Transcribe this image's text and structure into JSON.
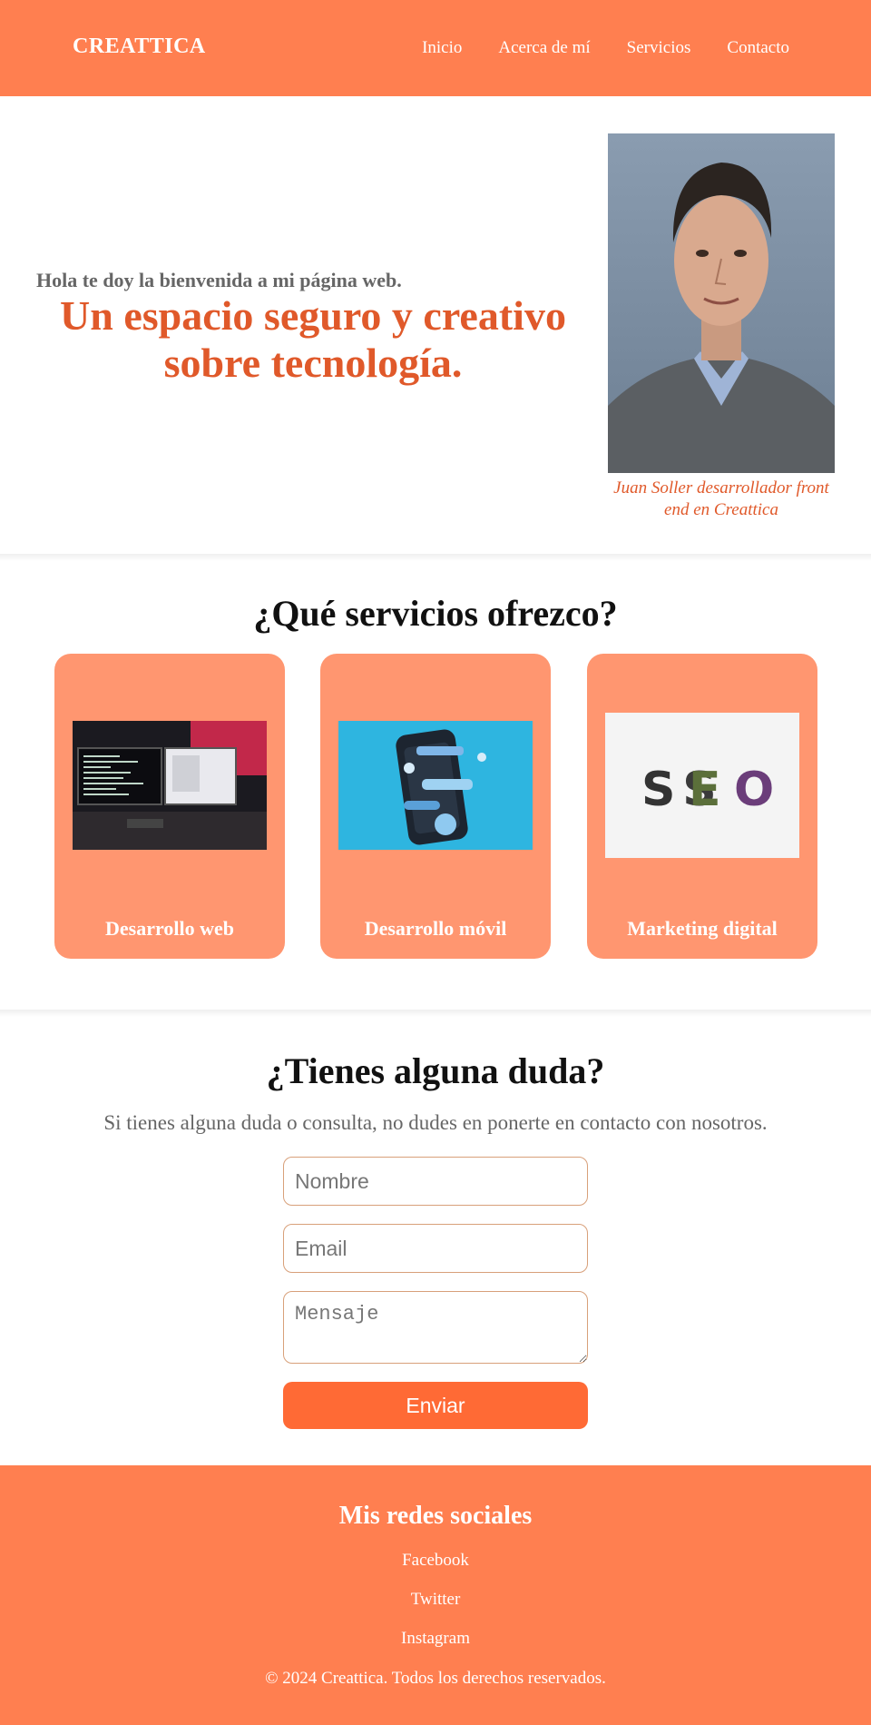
{
  "header": {
    "brand": "CREATTICA",
    "nav": [
      "Inicio",
      "Acerca de mí",
      "Servicios",
      "Contacto"
    ]
  },
  "hero": {
    "subtitle": "Hola te doy la bienvenida a mi página web.",
    "title": "Un espacio seguro y creativo sobre tecnología.",
    "caption": "Juan Soller desarrollador front end en Creattica"
  },
  "services": {
    "title": "¿Qué servicios ofrezco?",
    "cards": [
      {
        "label": "Desarrollo web"
      },
      {
        "label": "Desarrollo móvil"
      },
      {
        "label": "Marketing digital"
      }
    ]
  },
  "contact": {
    "title": "¿Tienes alguna duda?",
    "text": "Si tienes alguna duda o consulta, no dudes en ponerte en contacto con nosotros.",
    "name_placeholder": "Nombre",
    "email_placeholder": "Email",
    "message_placeholder": "Mensaje",
    "submit_label": "Enviar"
  },
  "footer": {
    "title": "Mis redes sociales",
    "links": [
      "Facebook",
      "Twitter",
      "Instagram"
    ],
    "copyright": "© 2024 Creattica. Todos los derechos reservados."
  },
  "colors": {
    "header_bg": "#ff7f50",
    "accent_text": "#e0592a",
    "card_bg": "#ff9670",
    "button_bg": "#ff6a35"
  }
}
